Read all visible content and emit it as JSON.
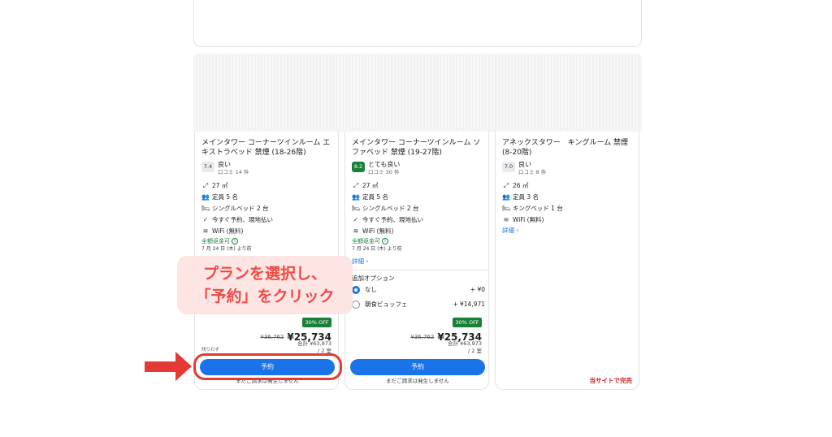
{
  "cards": [
    {
      "title": "メインタワー コーナーツインルーム エキストラベッド 禁煙 (18-26階)",
      "rating": {
        "score": "7.4",
        "label": "良い",
        "reviews": "口コミ 14 件"
      },
      "amenities": [
        {
          "icon": "room-size-icon",
          "text": "27 ㎡"
        },
        {
          "icon": "people-icon",
          "text": "定員 5 名"
        },
        {
          "icon": "bed-icon",
          "text": "シングルベッド 2 台"
        },
        {
          "icon": "check-icon",
          "text": "今すぐ予約、現地払い"
        },
        {
          "icon": "wifi-icon",
          "text": "WiFi (無料)"
        }
      ],
      "refund": "全額返金可",
      "refund_date": "7 月 24 日 (木) より前",
      "badge": "30% OFF",
      "old_price": "¥36,762",
      "new_price": "¥25,734",
      "total": "合計 ¥63,973",
      "nights": "/ 2 室",
      "note": "残りわず",
      "button": "予約",
      "no_charge": "まだご請求は発生しません"
    },
    {
      "title": "メインタワー コーナーツインルーム ソファベッド 禁煙 (19-27階)",
      "rating": {
        "score": "8.2",
        "label": "とても良い",
        "reviews": "口コミ 30 件"
      },
      "amenities": [
        {
          "icon": "room-size-icon",
          "text": "27 ㎡"
        },
        {
          "icon": "people-icon",
          "text": "定員 5 名"
        },
        {
          "icon": "bed-icon",
          "text": "シングルベッド 2 台"
        },
        {
          "icon": "check-icon",
          "text": "今すぐ予約、現地払い"
        },
        {
          "icon": "wifi-icon",
          "text": "WiFi (無料)"
        }
      ],
      "refund": "全額返金可",
      "refund_date": "7 月 24 日 (木) より前",
      "details": "詳細",
      "options_title": "追加オプション",
      "options": [
        {
          "label": "なし",
          "price": "+ ¥0",
          "selected": true
        },
        {
          "label": "朝食ビュッフェ",
          "price": "+ ¥14,971",
          "selected": false
        }
      ],
      "badge": "30% OFF",
      "old_price": "¥36,762",
      "new_price": "¥25,734",
      "total": "合計 ¥63,973",
      "nights": "/ 2 室",
      "button": "予約",
      "no_charge": "まだご請求は発生しません"
    },
    {
      "title": "アネックスタワー　キングルーム 禁煙 (8-20階)",
      "rating": {
        "score": "7.0",
        "label": "良い",
        "reviews": "口コミ 8 件"
      },
      "amenities": [
        {
          "icon": "room-size-icon",
          "text": "26 ㎡"
        },
        {
          "icon": "people-icon",
          "text": "定員 3 名"
        },
        {
          "icon": "bed-icon",
          "text": "キングベッド 1 台"
        },
        {
          "icon": "wifi-icon",
          "text": "WiFi (無料)"
        }
      ],
      "details": "詳細",
      "sold_out": "当サイトで完売"
    }
  ],
  "annotation": {
    "line1": "プランを選択し、",
    "line2": "「予約」をクリック"
  },
  "colors": {
    "primary": "#1a73e8",
    "discount": "#188038",
    "annotation": "#e53935"
  }
}
